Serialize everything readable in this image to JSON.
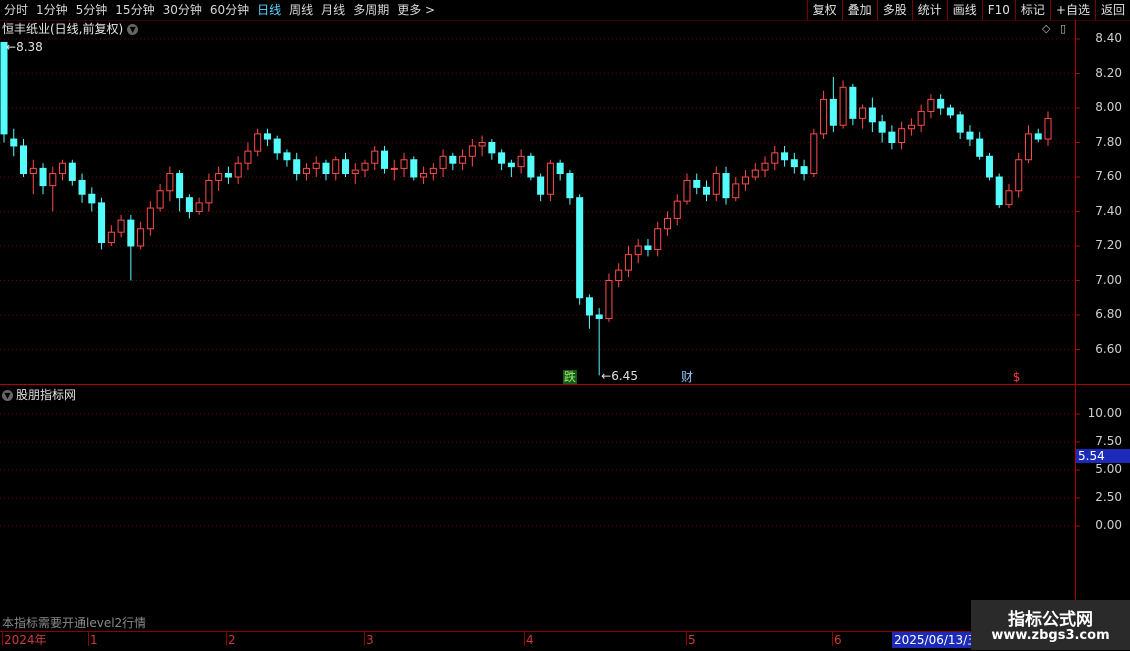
{
  "toolbar": {
    "periods": [
      {
        "label": "分时",
        "active": false
      },
      {
        "label": "1分钟",
        "active": false
      },
      {
        "label": "5分钟",
        "active": false
      },
      {
        "label": "15分钟",
        "active": false
      },
      {
        "label": "30分钟",
        "active": false
      },
      {
        "label": "60分钟",
        "active": false
      },
      {
        "label": "日线",
        "active": true
      },
      {
        "label": "周线",
        "active": false
      },
      {
        "label": "月线",
        "active": false
      },
      {
        "label": "多周期",
        "active": false
      },
      {
        "label": "更多 >",
        "active": false
      }
    ],
    "buttons": [
      "复权",
      "叠加",
      "多股",
      "统计",
      "画线",
      "F10",
      "标记",
      "+自选",
      "返回"
    ]
  },
  "main_chart": {
    "title": "恒丰纸业(日线,前复权)",
    "y_ticks": [
      "8.40",
      "8.20",
      "8.00",
      "7.80",
      "7.60",
      "7.40",
      "7.20",
      "7.00",
      "6.80",
      "6.60"
    ],
    "high_label": "8.38",
    "low_label": "6.45",
    "markers": [
      {
        "text": "跌",
        "color": "#9fe870",
        "bg": "#155a1a"
      },
      {
        "text": "财",
        "color": "#8ac8ff",
        "bg": ""
      },
      {
        "text": "$",
        "color": "#ff3a3a",
        "bg": ""
      }
    ]
  },
  "chart_data": {
    "type": "candlestick",
    "ylim": [
      6.45,
      8.45
    ],
    "up_color": "#ff4a4a",
    "down_color": "#54fcfc",
    "x": [
      "2024-12-30",
      "2024-12-31",
      "2025-01-02",
      "2025-01-03",
      "2025-01-06",
      "2025-01-07",
      "2025-01-08",
      "2025-01-09",
      "2025-01-10",
      "2025-01-13",
      "2025-01-14",
      "2025-01-15",
      "2025-01-16",
      "2025-01-17",
      "2025-01-20",
      "2025-01-21",
      "2025-01-22",
      "2025-01-23",
      "2025-01-24",
      "2025-01-27",
      "2025-02-05",
      "2025-02-06",
      "2025-02-07",
      "2025-02-10",
      "2025-02-11",
      "2025-02-12",
      "2025-02-13",
      "2025-02-14",
      "2025-02-17",
      "2025-02-18",
      "2025-02-19",
      "2025-02-20",
      "2025-02-21",
      "2025-02-24",
      "2025-02-25",
      "2025-02-26",
      "2025-02-27",
      "2025-02-28",
      "2025-03-03",
      "2025-03-04",
      "2025-03-05",
      "2025-03-06",
      "2025-03-07",
      "2025-03-10",
      "2025-03-11",
      "2025-03-12",
      "2025-03-13",
      "2025-03-14",
      "2025-03-17",
      "2025-03-18",
      "2025-03-19",
      "2025-03-20",
      "2025-03-21",
      "2025-03-24",
      "2025-03-25",
      "2025-03-26",
      "2025-03-27",
      "2025-03-28",
      "2025-03-31",
      "2025-04-01",
      "2025-04-02",
      "2025-04-03",
      "2025-04-07",
      "2025-04-08",
      "2025-04-09",
      "2025-04-10",
      "2025-04-11",
      "2025-04-14",
      "2025-04-15",
      "2025-04-16",
      "2025-04-17",
      "2025-04-18",
      "2025-04-21",
      "2025-04-22",
      "2025-04-23",
      "2025-04-24",
      "2025-04-25",
      "2025-04-28",
      "2025-04-29",
      "2025-04-30",
      "2025-05-06",
      "2025-05-07",
      "2025-05-08",
      "2025-05-09",
      "2025-05-12",
      "2025-05-13",
      "2025-05-14",
      "2025-05-15",
      "2025-05-16",
      "2025-05-19",
      "2025-05-20",
      "2025-05-21",
      "2025-05-22",
      "2025-05-23",
      "2025-05-26",
      "2025-05-27",
      "2025-05-28",
      "2025-05-29",
      "2025-05-30",
      "2025-06-03",
      "2025-06-04",
      "2025-06-05",
      "2025-06-06",
      "2025-06-09",
      "2025-06-10",
      "2025-06-11",
      "2025-06-12",
      "2025-06-13"
    ],
    "open": [
      8.38,
      7.82,
      7.78,
      7.62,
      7.65,
      7.55,
      7.62,
      7.68,
      7.58,
      7.5,
      7.45,
      7.22,
      7.28,
      7.35,
      7.2,
      7.3,
      7.42,
      7.52,
      7.62,
      7.48,
      7.4,
      7.45,
      7.58,
      7.62,
      7.6,
      7.68,
      7.75,
      7.85,
      7.82,
      7.74,
      7.7,
      7.62,
      7.65,
      7.68,
      7.62,
      7.7,
      7.62,
      7.64,
      7.68,
      7.75,
      7.65,
      7.65,
      7.7,
      7.6,
      7.62,
      7.65,
      7.72,
      7.68,
      7.72,
      7.78,
      7.8,
      7.74,
      7.68,
      7.66,
      7.72,
      7.6,
      7.5,
      7.68,
      7.62,
      7.48,
      6.9,
      6.8,
      6.78,
      7.0,
      7.06,
      7.15,
      7.2,
      7.18,
      7.3,
      7.36,
      7.46,
      7.58,
      7.54,
      7.5,
      7.62,
      7.48,
      7.56,
      7.6,
      7.64,
      7.68,
      7.74,
      7.7,
      7.66,
      7.62,
      7.85,
      8.05,
      7.9,
      8.12,
      7.94,
      8.0,
      7.92,
      7.86,
      7.8,
      7.88,
      7.9,
      7.98,
      8.05,
      8.0,
      7.96,
      7.86,
      7.82,
      7.72,
      7.6,
      7.44,
      7.52,
      7.7,
      7.85,
      7.82
    ],
    "close": [
      7.85,
      7.78,
      7.62,
      7.65,
      7.55,
      7.62,
      7.68,
      7.58,
      7.5,
      7.45,
      7.22,
      7.28,
      7.35,
      7.2,
      7.3,
      7.42,
      7.52,
      7.62,
      7.48,
      7.4,
      7.45,
      7.58,
      7.62,
      7.6,
      7.68,
      7.75,
      7.85,
      7.82,
      7.74,
      7.7,
      7.62,
      7.65,
      7.68,
      7.62,
      7.7,
      7.62,
      7.64,
      7.68,
      7.75,
      7.65,
      7.65,
      7.7,
      7.6,
      7.62,
      7.65,
      7.72,
      7.68,
      7.72,
      7.78,
      7.8,
      7.74,
      7.68,
      7.66,
      7.72,
      7.6,
      7.5,
      7.68,
      7.62,
      7.48,
      6.9,
      6.8,
      6.78,
      7.0,
      7.06,
      7.15,
      7.2,
      7.18,
      7.3,
      7.36,
      7.46,
      7.58,
      7.54,
      7.5,
      7.62,
      7.48,
      7.56,
      7.6,
      7.64,
      7.68,
      7.74,
      7.7,
      7.66,
      7.62,
      7.85,
      8.05,
      7.9,
      8.12,
      7.94,
      8.0,
      7.92,
      7.86,
      7.8,
      7.88,
      7.9,
      7.98,
      8.05,
      8.0,
      7.96,
      7.86,
      7.82,
      7.72,
      7.6,
      7.44,
      7.52,
      7.7,
      7.85,
      7.82,
      7.94
    ],
    "high": [
      8.38,
      7.88,
      7.82,
      7.7,
      7.68,
      7.66,
      7.7,
      7.7,
      7.62,
      7.54,
      7.48,
      7.32,
      7.38,
      7.38,
      7.34,
      7.46,
      7.56,
      7.66,
      7.64,
      7.5,
      7.48,
      7.62,
      7.66,
      7.66,
      7.72,
      7.8,
      7.88,
      7.88,
      7.84,
      7.76,
      7.74,
      7.68,
      7.72,
      7.7,
      7.72,
      7.74,
      7.68,
      7.7,
      7.78,
      7.78,
      7.7,
      7.74,
      7.72,
      7.66,
      7.68,
      7.76,
      7.74,
      7.76,
      7.82,
      7.84,
      7.82,
      7.76,
      7.7,
      7.76,
      7.74,
      7.62,
      7.7,
      7.7,
      7.64,
      7.5,
      6.92,
      6.84,
      7.04,
      7.1,
      7.2,
      7.24,
      7.24,
      7.34,
      7.4,
      7.5,
      7.62,
      7.62,
      7.58,
      7.66,
      7.66,
      7.6,
      7.64,
      7.68,
      7.72,
      7.78,
      7.78,
      7.74,
      7.7,
      7.88,
      8.1,
      8.18,
      8.16,
      8.14,
      8.02,
      8.06,
      7.96,
      7.9,
      7.92,
      7.94,
      8.02,
      8.08,
      8.08,
      8.02,
      7.98,
      7.9,
      7.86,
      7.74,
      7.62,
      7.56,
      7.74,
      7.9,
      7.88,
      7.98
    ],
    "low": [
      7.8,
      7.72,
      7.6,
      7.5,
      7.5,
      7.4,
      7.58,
      7.55,
      7.45,
      7.4,
      7.18,
      7.2,
      7.25,
      7.0,
      7.18,
      7.26,
      7.4,
      7.46,
      7.4,
      7.36,
      7.38,
      7.4,
      7.52,
      7.56,
      7.56,
      7.64,
      7.72,
      7.78,
      7.7,
      7.66,
      7.58,
      7.58,
      7.6,
      7.58,
      7.58,
      7.6,
      7.56,
      7.6,
      7.64,
      7.62,
      7.58,
      7.6,
      7.58,
      7.56,
      7.58,
      7.6,
      7.64,
      7.64,
      7.66,
      7.72,
      7.7,
      7.64,
      7.6,
      7.62,
      7.58,
      7.46,
      7.46,
      7.58,
      7.44,
      6.86,
      6.72,
      6.45,
      6.76,
      6.96,
      7.02,
      7.1,
      7.14,
      7.14,
      7.26,
      7.32,
      7.44,
      7.5,
      7.46,
      7.46,
      7.44,
      7.46,
      7.52,
      7.58,
      7.6,
      7.64,
      7.66,
      7.62,
      7.58,
      7.6,
      7.82,
      7.86,
      7.88,
      7.9,
      7.88,
      7.86,
      7.8,
      7.76,
      7.76,
      7.84,
      7.86,
      7.94,
      7.96,
      7.94,
      7.82,
      7.78,
      7.7,
      7.58,
      7.42,
      7.42,
      7.48,
      7.68,
      7.8,
      7.78
    ]
  },
  "sub_chart": {
    "title": "股朋指标网",
    "y_ticks": [
      "10.00",
      "7.50",
      "5.00",
      "2.50",
      "0.00"
    ],
    "current_value": "5.54",
    "note": "本指标需要开通level2行情"
  },
  "date_axis": {
    "labels": [
      "2024年",
      "1",
      "2",
      "3",
      "4",
      "5",
      "6"
    ],
    "selected_date": "2025/06/13/五"
  },
  "watermark": {
    "line1": "指标公式网",
    "line2": "www.zbgs3.com"
  }
}
